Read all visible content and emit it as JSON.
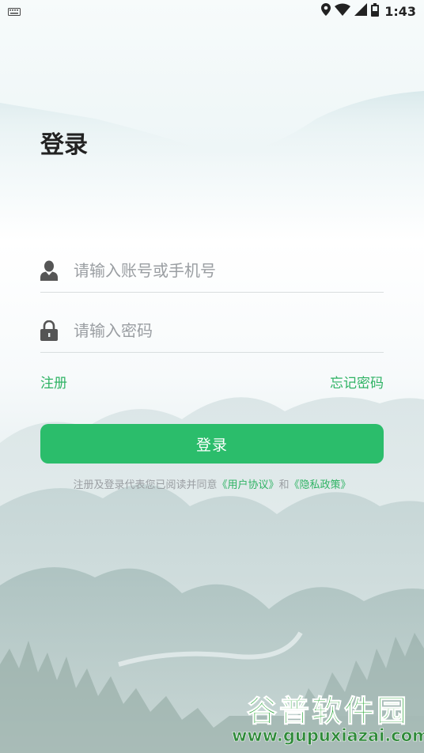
{
  "status_bar": {
    "time": "1:43",
    "icons": [
      "keyboard-icon",
      "location-icon",
      "wifi-icon",
      "signal-icon",
      "battery-icon"
    ]
  },
  "page": {
    "title": "登录"
  },
  "form": {
    "account_placeholder": "请输入账号或手机号",
    "account_value": "",
    "password_placeholder": "请输入密码",
    "password_value": "",
    "account_icon": "user-icon",
    "password_icon": "lock-icon"
  },
  "links": {
    "register": "注册",
    "forgot_password": "忘记密码"
  },
  "login_button": "登录",
  "agreement": {
    "prefix": "注册及登录代表您已阅读并同意",
    "user_agreement": "《用户协议》",
    "conjunction": "和",
    "privacy_policy": "《隐私政策》"
  },
  "watermark": {
    "title": "谷普软件园",
    "url": "www.gupuxiazai.com"
  },
  "colors": {
    "accent": "#2bbd6b",
    "link": "#2fb364",
    "placeholder": "#9a9ea2"
  }
}
